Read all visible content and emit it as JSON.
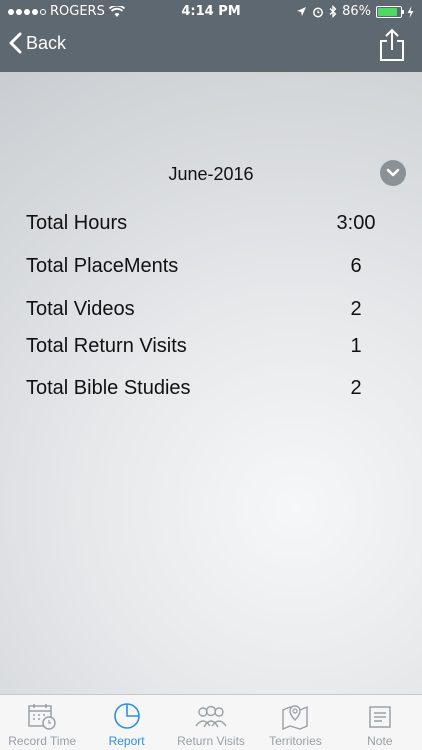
{
  "status_bar": {
    "carrier": "ROGERS",
    "time": "4:14 PM",
    "battery_percent": "86%",
    "battery_level": 0.86,
    "icons": [
      "signal-dots-icon",
      "wifi-icon",
      "location-icon",
      "alarm-icon",
      "bluetooth-icon",
      "battery-icon",
      "charging-icon"
    ]
  },
  "nav": {
    "back_label": "Back",
    "share_icon": "share-icon"
  },
  "report": {
    "month": "June-2016",
    "rows": [
      {
        "label": "Total Hours",
        "value": "3:00"
      },
      {
        "label": "Total PlaceMents",
        "value": "6"
      },
      {
        "label": "Total Videos",
        "value": "2"
      },
      {
        "label": "Total Return Visits",
        "value": "1"
      },
      {
        "label": "Total Bible Studies",
        "value": "2"
      }
    ]
  },
  "tabs": [
    {
      "label": "Record Time",
      "icon": "calendar-icon",
      "active": false
    },
    {
      "label": "Report",
      "icon": "pie-chart-icon",
      "active": true
    },
    {
      "label": "Return Visits",
      "icon": "people-icon",
      "active": false
    },
    {
      "label": "Territories",
      "icon": "map-icon",
      "active": false
    },
    {
      "label": "Note",
      "icon": "note-icon",
      "active": false
    }
  ],
  "colors": {
    "nav_bar": "#5e6870",
    "active_tab": "#2f8fe0",
    "inactive_tab": "#9aa0a6",
    "battery_fill": "#4cd964"
  }
}
